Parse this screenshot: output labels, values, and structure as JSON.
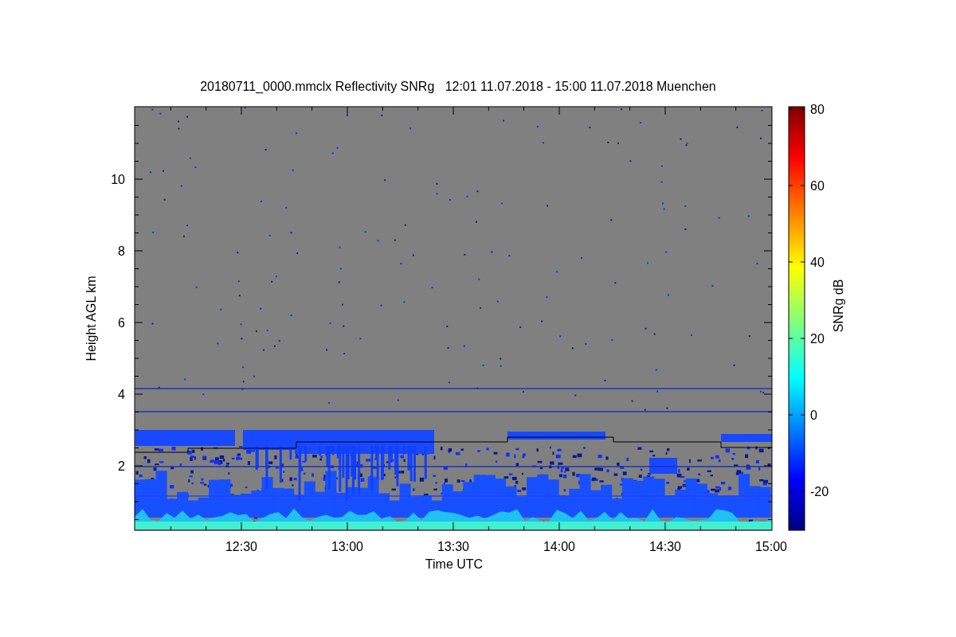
{
  "title": "20180711_0000.mmclx Reflectivity SNRg   12:01 11.07.2018 - 15:00 11.07.2018 Muenchen",
  "plot": {
    "xlabel": "Time UTC",
    "ylabel": "Height AGL km",
    "xticks": [
      "12:30",
      "13:00",
      "13:30",
      "14:00",
      "14:30",
      "15:00"
    ],
    "yticks": [
      "10",
      "8",
      "6",
      "4",
      "2"
    ]
  },
  "colorbar": {
    "label": "SNRg dB",
    "ticks": [
      "80",
      "60",
      "40",
      "20",
      "0",
      "-20"
    ]
  }
}
